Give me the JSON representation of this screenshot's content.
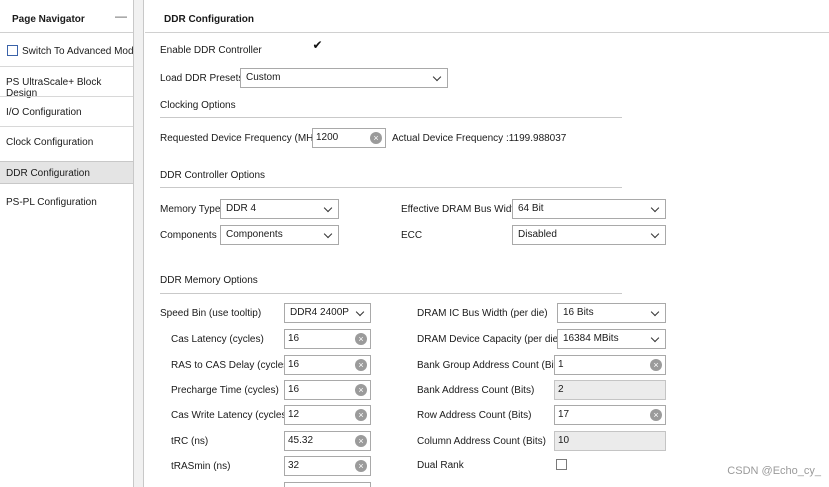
{
  "navigator": {
    "title": "Page Navigator",
    "minimize": "—",
    "switch_label": "Switch To Advanced Mode",
    "items": [
      "PS UltraScale+ Block Design",
      "I/O Configuration",
      "Clock Configuration",
      "DDR Configuration",
      "PS-PL Configuration"
    ],
    "active_item": "DDR Configuration"
  },
  "main": {
    "title": "DDR Configuration",
    "enable_label": "Enable DDR Controller",
    "enable_checked": "✔",
    "presets_label": "Load DDR Presets",
    "presets_value": "Custom",
    "clocking": {
      "heading": "Clocking Options",
      "req_freq_label": "Requested Device Frequency (MHz)",
      "req_freq_value": "1200",
      "actual_freq_label": "Actual Device Frequency :1199.988037"
    },
    "controller": {
      "heading": "DDR Controller Options",
      "memory_type_label": "Memory Type",
      "memory_type_value": "DDR 4",
      "components_label": "Components",
      "components_value": "Components",
      "bus_width_label": "Effective DRAM Bus Width",
      "bus_width_value": "64 Bit",
      "ecc_label": "ECC",
      "ecc_value": "Disabled"
    },
    "memory": {
      "heading": "DDR Memory Options",
      "speed_bin_label": "Speed Bin (use tooltip)",
      "speed_bin_value": "DDR4 2400P",
      "left_fields": [
        {
          "label": "Cas Latency (cycles)",
          "value": "16"
        },
        {
          "label": "RAS to CAS Delay (cycles)",
          "value": "16"
        },
        {
          "label": "Precharge Time (cycles)",
          "value": "16"
        },
        {
          "label": "Cas Write Latency (cycles)",
          "value": "12"
        },
        {
          "label": "tRC (ns)",
          "value": "45.32"
        },
        {
          "label": "tRASmin (ns)",
          "value": "32"
        }
      ],
      "ic_bus_width_label": "DRAM IC Bus Width (per die)",
      "ic_bus_width_value": "16 Bits",
      "capacity_label": "DRAM Device Capacity (per die)",
      "capacity_value": "16384 MBits",
      "bank_group_label": "Bank Group Address Count (Bits)",
      "bank_group_value": "1",
      "bank_addr_label": "Bank Address Count (Bits)",
      "bank_addr_value": "2",
      "row_addr_label": "Row Address Count (Bits)",
      "row_addr_value": "17",
      "col_addr_label": "Column Address Count (Bits)",
      "col_addr_value": "10",
      "dual_rank_label": "Dual Rank"
    }
  },
  "clear_glyph": "×",
  "watermark": "CSDN @Echo_cy_",
  "colors": {
    "accent_checkbox": "#3b63a9",
    "active_nav_bg": "#e4e4e4",
    "readonly_bg": "#ebebeb"
  }
}
